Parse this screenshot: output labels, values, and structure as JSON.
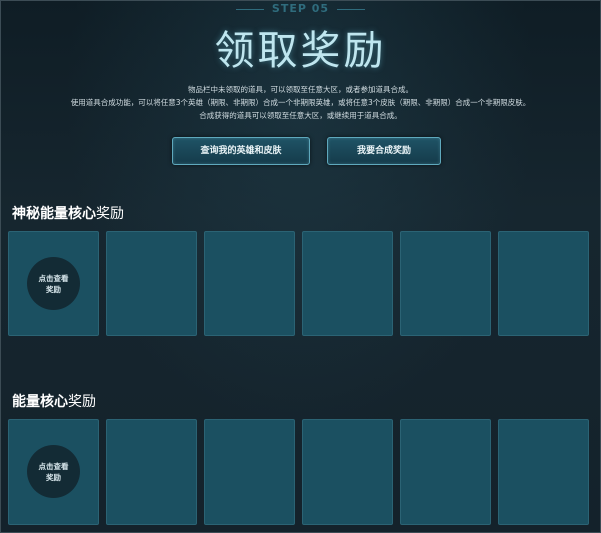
{
  "header": {
    "step": "STEP 05",
    "title": "领取奖励"
  },
  "description": {
    "line1": "物品栏中未领取的道具，可以领取至任意大区，或者参加道具合成。",
    "line2": "使用道具合成功能，可以将任意3个英雄（期限、非期限）合成一个非期限英雄，或将任意3个皮肤（期限、非期限）合成一个非期限皮肤。",
    "line3": "合成获得的道具可以领取至任意大区，或继续用于道具合成。"
  },
  "buttons": {
    "query": "查询我的英雄和皮肤",
    "compose": "我要合成奖励"
  },
  "section1": {
    "title_bold": "神秘能量核心",
    "title_light": "奖励",
    "circle_line1": "点击查看",
    "circle_line2": "奖励"
  },
  "section2": {
    "title_bold": "能量核心",
    "title_light": "奖励",
    "circle_line1": "点击查看",
    "circle_line2": "奖励"
  }
}
